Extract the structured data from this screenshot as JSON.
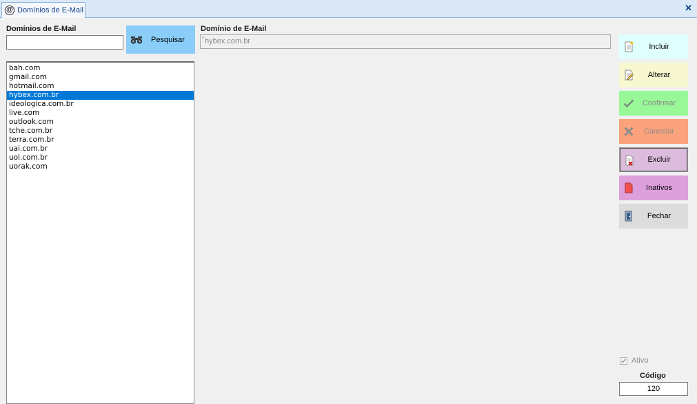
{
  "window": {
    "tab_title": "Domínios de E-Mail",
    "close_glyph": "✕"
  },
  "search": {
    "label": "Domínios de E-Mail",
    "value": "",
    "button_label": "Pesquisar"
  },
  "domain_list": {
    "items": [
      "bah.com",
      "gmail.com",
      "hotmail.com",
      "hybex.com.br",
      "ideologica.com.br",
      "live.com",
      "outlook.com",
      "tche.com.br",
      "terra.com.br",
      "uai.com.br",
      "uol.com.br",
      "uorak.com"
    ],
    "selected_index": 3
  },
  "detail": {
    "label": "Domínio de E-Mail",
    "value": "hybex.com.br"
  },
  "actions": [
    {
      "name": "incluir-button",
      "label": "Incluir",
      "icon": "new-document-icon",
      "bg": "#e0ffff",
      "enabled": true
    },
    {
      "name": "alterar-button",
      "label": "Alterar",
      "icon": "edit-document-icon",
      "bg": "#f8f8d0",
      "enabled": true
    },
    {
      "name": "confirmar-button",
      "label": "Confirmar",
      "icon": "check-icon",
      "bg": "#98f898",
      "enabled": false
    },
    {
      "name": "cancelar-button",
      "label": "Cancelar",
      "icon": "x-icon",
      "bg": "#fca27c",
      "enabled": false
    },
    {
      "name": "excluir-button",
      "label": "Excluir",
      "icon": "delete-document-icon",
      "bg": "#dcbcdc",
      "enabled": true
    },
    {
      "name": "inativos-button",
      "label": "Inativos",
      "icon": "red-document-icon",
      "bg": "#dda0dd",
      "enabled": true
    },
    {
      "name": "fechar-button",
      "label": "Fechar",
      "icon": "exit-door-icon",
      "bg": "#dcdcdc",
      "enabled": true
    }
  ],
  "status": {
    "ativo_label": "Ativo",
    "ativo_checked": true,
    "codigo_label": "Código",
    "codigo_value": "120"
  }
}
